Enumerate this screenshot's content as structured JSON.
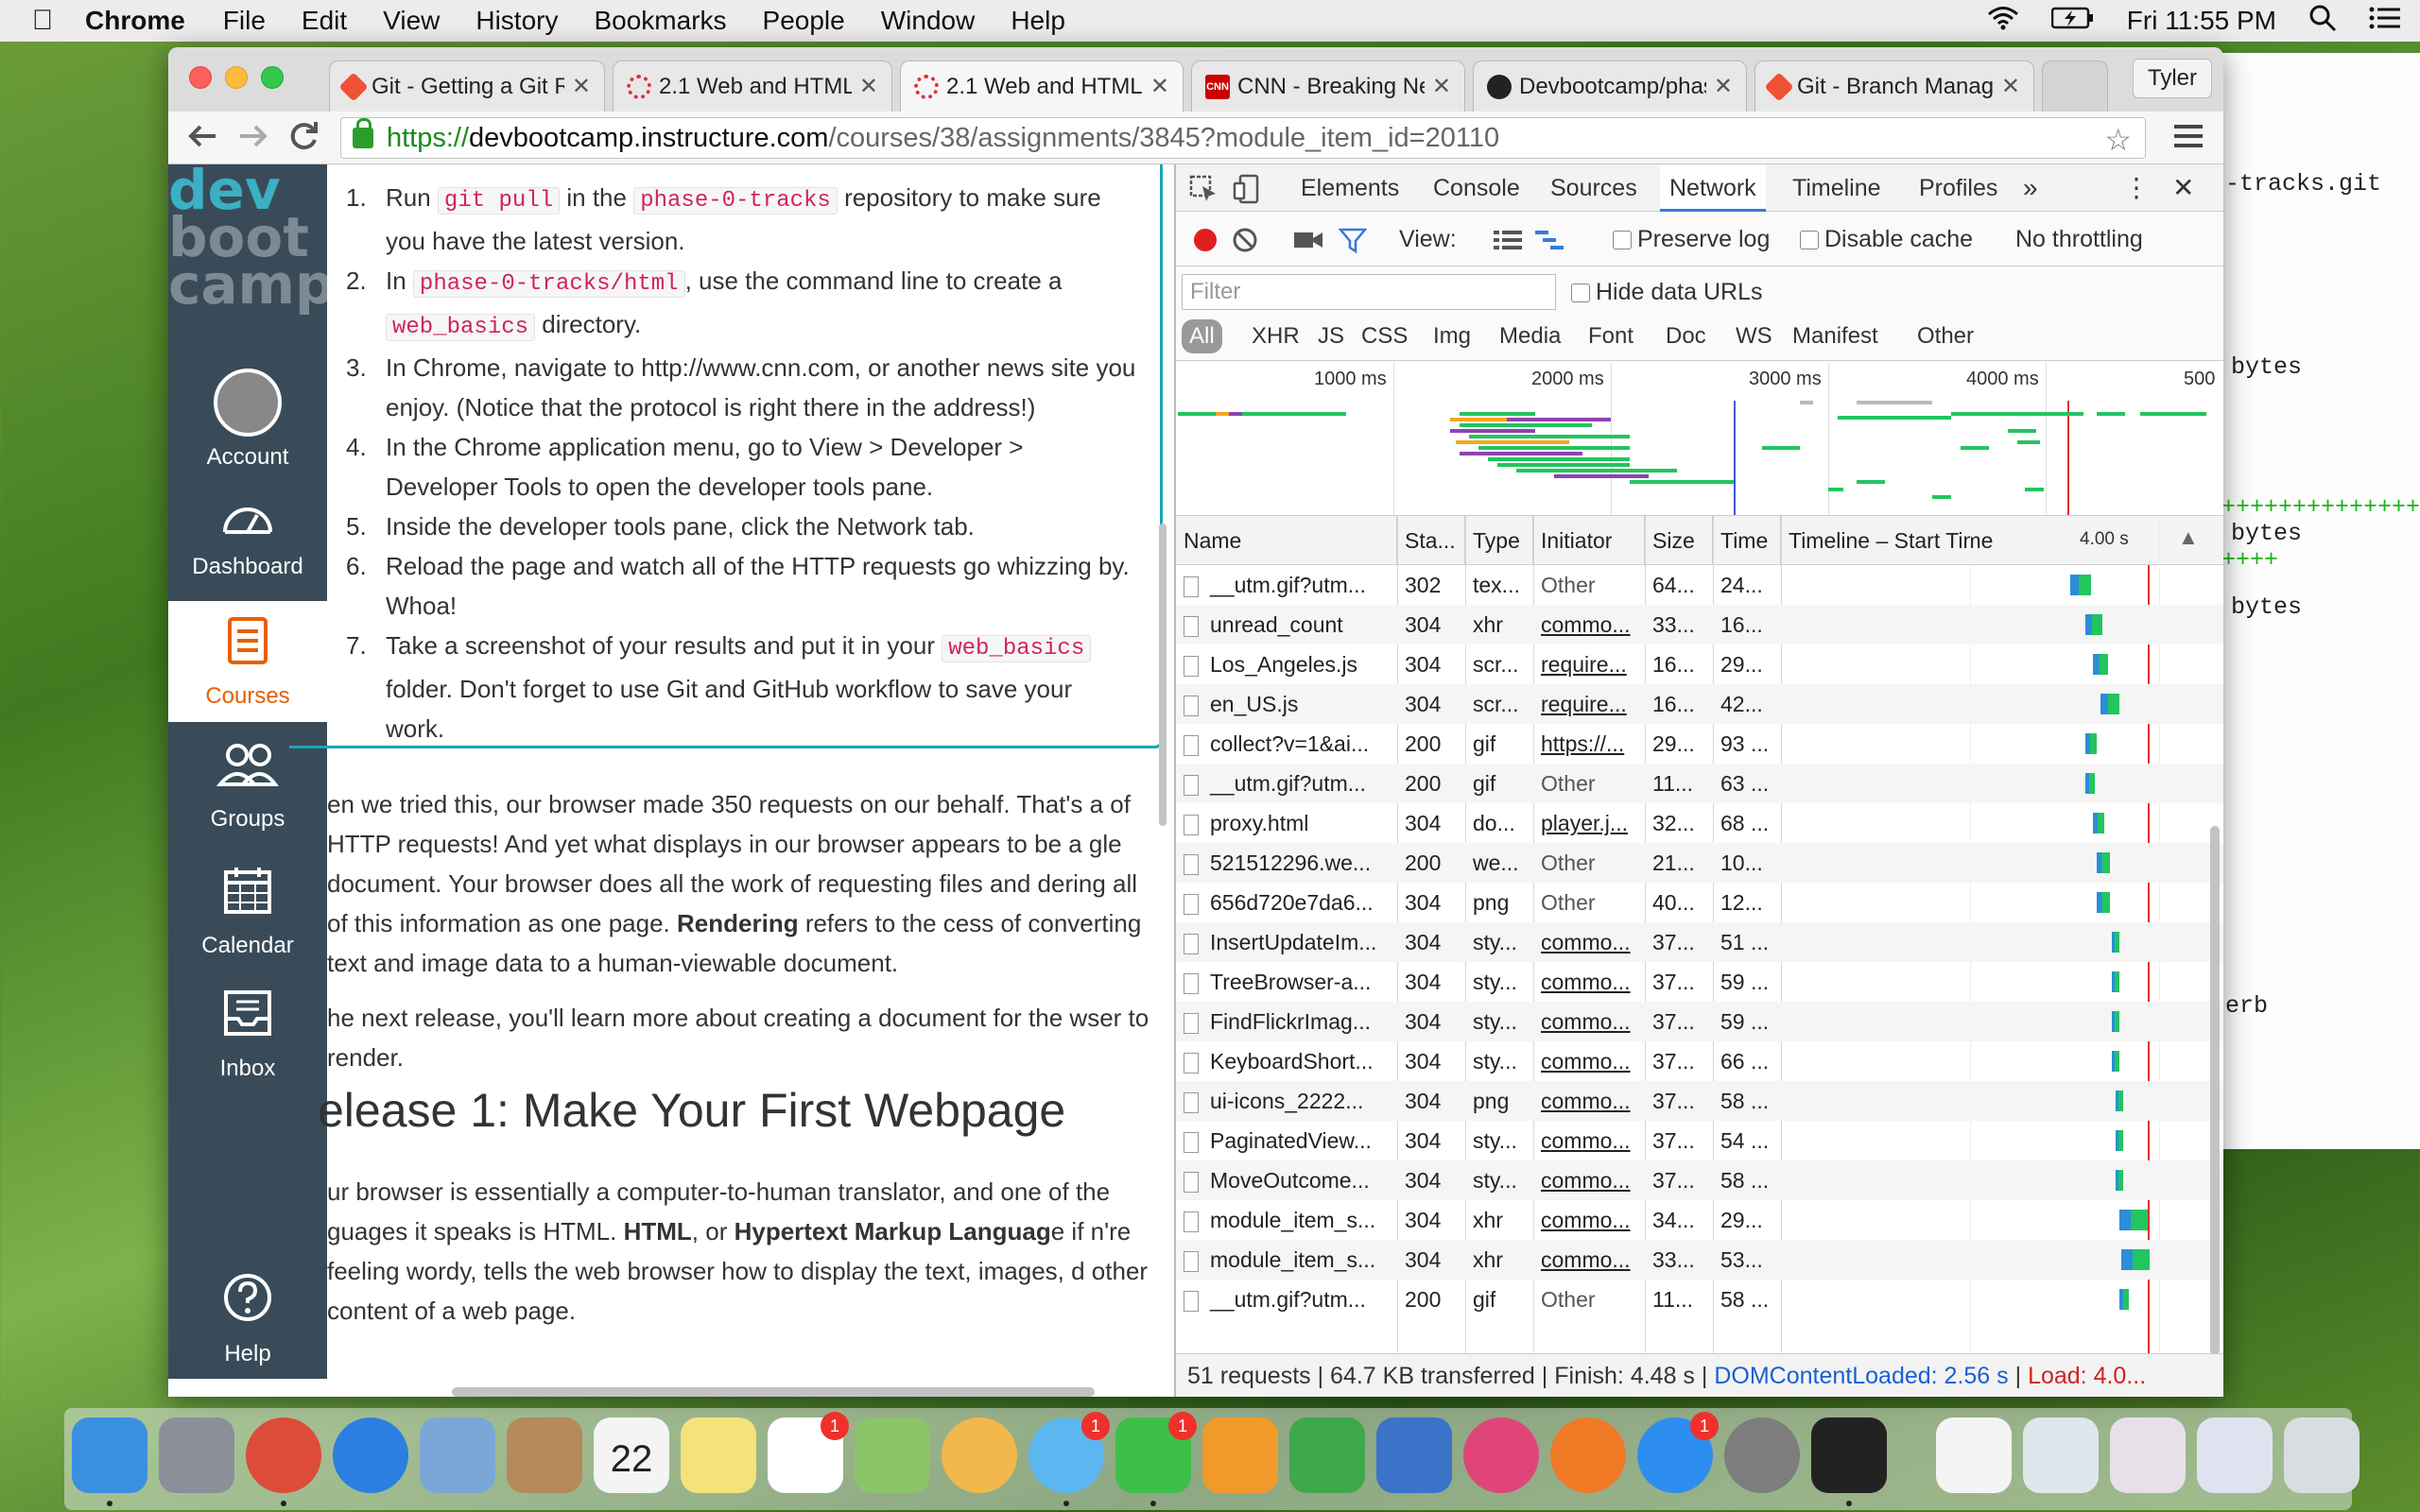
{
  "menubar": {
    "apple": "",
    "app": "Chrome",
    "items": [
      "File",
      "Edit",
      "View",
      "History",
      "Bookmarks",
      "People",
      "Window",
      "Help"
    ],
    "clock": "Fri 11:55 PM"
  },
  "terminal": {
    "lines": [
      "-tracks.git",
      "bytes",
      "+++++++++++++++",
      "bytes",
      "++++",
      "bytes",
      "erb"
    ]
  },
  "browser": {
    "tabs": [
      {
        "title": "Git - Getting a Git R",
        "favicon": "git-icon",
        "color": "#f05033"
      },
      {
        "title": "2.1 Web and HTML",
        "favicon": "canvas-icon",
        "color": "#e0303a"
      },
      {
        "title": "2.1 Web and HTML",
        "favicon": "canvas-icon",
        "color": "#e0303a"
      },
      {
        "title": "CNN - Breaking Ne",
        "favicon": "cnn-icon",
        "color": "#cc0000"
      },
      {
        "title": "Devbootcamp/phas",
        "favicon": "github-icon",
        "color": "#222222"
      },
      {
        "title": "Git - Branch Manag",
        "favicon": "git-icon",
        "color": "#f05033"
      }
    ],
    "profile": "Tyler",
    "url": {
      "scheme": "https://",
      "host": "devbootcamp.instructure.com",
      "path": "/courses/38/assignments/3845?module_item_id=20110"
    }
  },
  "canvas": {
    "logo": {
      "line1": "dev",
      "line2": "boot",
      "line3": "camp"
    },
    "nav": [
      {
        "label": "Account",
        "icon": "account-icon"
      },
      {
        "label": "Dashboard",
        "icon": "dashboard-icon"
      },
      {
        "label": "Courses",
        "icon": "courses-icon"
      },
      {
        "label": "Groups",
        "icon": "groups-icon"
      },
      {
        "label": "Calendar",
        "icon": "calendar-icon"
      },
      {
        "label": "Inbox",
        "icon": "inbox-icon"
      },
      {
        "label": "Help",
        "icon": "help-icon"
      }
    ],
    "steps": [
      {
        "n": "1.",
        "a": "Run ",
        "code1": "git pull",
        "b": " in the ",
        "code2": "phase-0-tracks",
        "c": " repository to make sure you have the latest version."
      },
      {
        "n": "2.",
        "a": "In ",
        "code1": "phase-0-tracks/html",
        "b": ", use the command line to create a ",
        "code2": "web_basics",
        "c": " directory."
      },
      {
        "n": "3.",
        "a": "In Chrome, navigate to http://www.cnn.com, or another news site you enjoy. (Notice that the protocol is right there in the address!)"
      },
      {
        "n": "4.",
        "a": "In the Chrome application menu, go to View > Developer > Developer Tools to open the developer tools pane."
      },
      {
        "n": "5.",
        "a": "Inside the developer tools pane, click the Network tab."
      },
      {
        "n": "6.",
        "a": "Reload the page and watch all of the HTTP requests go whizzing by. Whoa!"
      },
      {
        "n": "7.",
        "a": "Take a screenshot of your results and put it in your ",
        "code1": "web_basics",
        "b": " folder. Don't forget to use Git and GitHub workflow to save your work."
      }
    ],
    "para1": {
      "a": "en we tried this, our browser made 350 requests on our behalf. That's a of HTTP requests! And yet what displays in our browser appears to be a gle document. Your browser does all the work of requesting files and dering all of this information as one page. ",
      "b": "Rendering",
      "c": " refers to the cess of converting text and image data to a human-viewable document."
    },
    "para2": "he next release, you'll learn more about creating a document for the wser to render.",
    "heading": "elease 1: Make Your First Webpage",
    "para3": {
      "a": "ur browser is essentially a computer-to-human translator, and one of the guages it speaks is HTML. ",
      "b": "HTML",
      "c": ", or ",
      "d": "Hypertext Markup Languag",
      "e": "e if n're feeling wordy, tells the web browser how to display the text, images, d other content of a web page."
    }
  },
  "devtools": {
    "tabs": [
      "Elements",
      "Console",
      "Sources",
      "Network",
      "Timeline",
      "Profiles",
      "»"
    ],
    "active_tab": "Network",
    "controls": {
      "view": "View:",
      "preserve": "Preserve log",
      "disable": "Disable cache",
      "throttle": "No throttling"
    },
    "filter_placeholder": "Filter",
    "hide_urls": "Hide data URLs",
    "types": [
      "All",
      "XHR",
      "JS",
      "CSS",
      "Img",
      "Media",
      "Font",
      "Doc",
      "WS",
      "Manifest",
      "Other"
    ],
    "overview_ticks": [
      "1000 ms",
      "2000 ms",
      "3000 ms",
      "4000 ms",
      "500"
    ],
    "columns": [
      "Name",
      "Sta...",
      "Type",
      "Initiator",
      "Size",
      "Time",
      "Timeline – Start Time"
    ],
    "waterfall_scale": "4.00 s",
    "rows": [
      {
        "name": "__utm.gif?utm...",
        "status": "302",
        "type": "tex...",
        "initiator": "Other",
        "size": "64...",
        "time": "24..."
      },
      {
        "name": "unread_count",
        "status": "304",
        "type": "xhr",
        "initiator": "commo...",
        "size": "33...",
        "time": "16..."
      },
      {
        "name": "Los_Angeles.js",
        "status": "304",
        "type": "scr...",
        "initiator": "require...",
        "size": "16...",
        "time": "29..."
      },
      {
        "name": "en_US.js",
        "status": "304",
        "type": "scr...",
        "initiator": "require...",
        "size": "16...",
        "time": "42..."
      },
      {
        "name": "collect?v=1&ai...",
        "status": "200",
        "type": "gif",
        "initiator": "https://...",
        "size": "29...",
        "time": "93 ..."
      },
      {
        "name": "__utm.gif?utm...",
        "status": "200",
        "type": "gif",
        "initiator": "Other",
        "size": "11...",
        "time": "63 ..."
      },
      {
        "name": "proxy.html",
        "status": "304",
        "type": "do...",
        "initiator": "player.j...",
        "size": "32...",
        "time": "68 ..."
      },
      {
        "name": "521512296.we...",
        "status": "200",
        "type": "we...",
        "initiator": "Other",
        "size": "21...",
        "time": "10..."
      },
      {
        "name": "656d720e7da6...",
        "status": "304",
        "type": "png",
        "initiator": "Other",
        "size": "40...",
        "time": "12..."
      },
      {
        "name": "InsertUpdateIm...",
        "status": "304",
        "type": "sty...",
        "initiator": "commo...",
        "size": "37...",
        "time": "51 ..."
      },
      {
        "name": "TreeBrowser-a...",
        "status": "304",
        "type": "sty...",
        "initiator": "commo...",
        "size": "37...",
        "time": "59 ..."
      },
      {
        "name": "FindFlickrImag...",
        "status": "304",
        "type": "sty...",
        "initiator": "commo...",
        "size": "37...",
        "time": "59 ..."
      },
      {
        "name": "KeyboardShort...",
        "status": "304",
        "type": "sty...",
        "initiator": "commo...",
        "size": "37...",
        "time": "66 ..."
      },
      {
        "name": "ui-icons_2222...",
        "status": "304",
        "type": "png",
        "initiator": "commo...",
        "size": "37...",
        "time": "58 ..."
      },
      {
        "name": "PaginatedView...",
        "status": "304",
        "type": "sty...",
        "initiator": "commo...",
        "size": "37...",
        "time": "54 ..."
      },
      {
        "name": "MoveOutcome...",
        "status": "304",
        "type": "sty...",
        "initiator": "commo...",
        "size": "37...",
        "time": "58 ..."
      },
      {
        "name": "module_item_s...",
        "status": "304",
        "type": "xhr",
        "initiator": "commo...",
        "size": "34...",
        "time": "29..."
      },
      {
        "name": "module_item_s...",
        "status": "304",
        "type": "xhr",
        "initiator": "commo...",
        "size": "33...",
        "time": "53..."
      },
      {
        "name": "__utm.gif?utm...",
        "status": "200",
        "type": "gif",
        "initiator": "Other",
        "size": "11...",
        "time": "58 ..."
      }
    ],
    "status": {
      "requests": "51 requests",
      "transferred": "64.7 KB transferred",
      "finish": "Finish: 4.48 s",
      "dcl": "DOMContentLoaded: 2.56 s",
      "load": "Load: 4.0..."
    }
  },
  "dock": {
    "apps": [
      {
        "name": "finder-icon",
        "color": "#3b8fe0",
        "running": true
      },
      {
        "name": "launchpad-icon",
        "color": "#8a8f99",
        "running": false
      },
      {
        "name": "chrome-icon",
        "color": "#dd4b39",
        "running": true
      },
      {
        "name": "safari-icon",
        "color": "#2b7fe0",
        "running": false
      },
      {
        "name": "mail-icon",
        "color": "#7aa7d8",
        "running": false
      },
      {
        "name": "contacts-icon",
        "color": "#b48a5a",
        "running": false
      },
      {
        "name": "calendar-icon",
        "color": "#f4f4f4",
        "running": false,
        "label": "22"
      },
      {
        "name": "notes-icon",
        "color": "#f6e27a",
        "running": false
      },
      {
        "name": "reminders-icon",
        "color": "#ffffff",
        "running": false,
        "badge": "1"
      },
      {
        "name": "maps-icon",
        "color": "#8cc46a",
        "running": false
      },
      {
        "name": "photos-icon",
        "color": "#f2b84b",
        "running": false
      },
      {
        "name": "messages-icon",
        "color": "#5cb6f0",
        "running": true,
        "badge": "1"
      },
      {
        "name": "facetime-icon",
        "color": "#3cc04a",
        "running": true,
        "badge": "1"
      },
      {
        "name": "pages-icon",
        "color": "#f09a2a",
        "running": false
      },
      {
        "name": "numbers-icon",
        "color": "#3fa84b",
        "running": false
      },
      {
        "name": "keynote-icon",
        "color": "#3a73c8",
        "running": false
      },
      {
        "name": "itunes-icon",
        "color": "#e0457a",
        "running": false
      },
      {
        "name": "ibooks-icon",
        "color": "#f07a26",
        "running": false
      },
      {
        "name": "appstore-icon",
        "color": "#2d8ef0",
        "running": false,
        "badge": "1"
      },
      {
        "name": "system-preferences-icon",
        "color": "#7d7d7d",
        "running": false
      },
      {
        "name": "terminal-icon",
        "color": "#222222",
        "running": true
      },
      {
        "name": "document-icon",
        "color": "#f4f4f4",
        "running": false
      },
      {
        "name": "screenshot-icon",
        "color": "#dfe6ee",
        "running": false
      },
      {
        "name": "screenshot-icon",
        "color": "#e6e1e8",
        "running": false
      },
      {
        "name": "screenshot-icon",
        "color": "#dfe3f0",
        "running": false
      },
      {
        "name": "trash-icon",
        "color": "#d9dde2",
        "running": false
      }
    ]
  }
}
